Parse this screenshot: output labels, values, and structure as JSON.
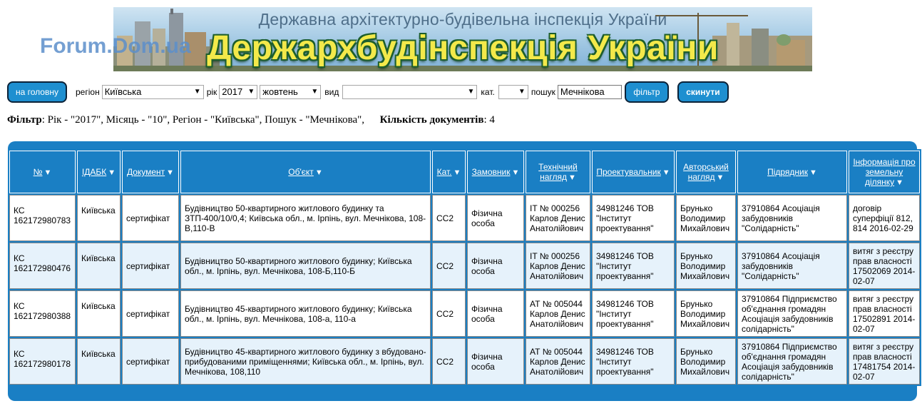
{
  "banner": {
    "subtitle": "Державна архітектурно-будівельна інспекція України",
    "title": "Держархбудінспекція України"
  },
  "watermark": "Forum.Dom.ua",
  "toolbar": {
    "home_label": "на головну",
    "region_label": "регіон",
    "region_value": "Київська",
    "year_label": "рік",
    "year_value": "2017",
    "month_value": "жовтень",
    "type_label": "вид",
    "type_value": "",
    "cat_label": "кат.",
    "cat_value": "",
    "search_label": "пошук",
    "search_value": "Мечнікова",
    "filter_label": "фільтр",
    "reset_label": "скинути"
  },
  "filter_summary": {
    "filter_key": "Фільтр",
    "filter_text": ": Рік - \"2017\", Місяць - \"10\", Регіон - \"Київська\", Пошук - \"Мечнікова\",",
    "count_key": "Кількість документів",
    "count_text": ": 4"
  },
  "table": {
    "headers": [
      "№",
      "ІДАБК",
      "Документ",
      "Об'єкт",
      "Кат.",
      "Замовник",
      "Технічний нагляд",
      "Проектувальник",
      "Авторський нагляд",
      "Підрядник",
      "Інформація про земельну ділянку"
    ],
    "rows": [
      {
        "num": "КС 162172980783",
        "idabk": "Київська",
        "doc": "сертифікат",
        "object": "Будівництво 50-квартирного житлового будинку та ЗТП-400/10/0,4; Київська обл., м. Ірпінь, вул. Мечнікова, 108-В,110-В",
        "cat": "СС2",
        "customer": "Фізична особа",
        "tech": "IT № 000256 Карлов Денис Анатолійович",
        "designer": "34981246 ТОВ \"Інститут проектування\"",
        "author": "Брунько Володимир Михайлович",
        "contractor": "37910864 Асоціація забудовників \"Солідарність\"",
        "land": "договір суперфіції 812, 814 2016-02-29"
      },
      {
        "num": "КС 162172980476",
        "idabk": "Київська",
        "doc": "сертифікат",
        "object": "Будівництво 50-квартирного житлового будинку; Київська обл., м. Ірпінь, вул. Мечнікова, 108-Б,110-Б",
        "cat": "СС2",
        "customer": "Фізична особа",
        "tech": "IT № 000256 Карлов Денис Анатолійович",
        "designer": "34981246 ТОВ \"Інститут проектування\"",
        "author": "Брунько Володимир Михайлович",
        "contractor": "37910864 Асоціація забудовників \"Солідарність\"",
        "land": "витяг з реєстру прав власності 17502069 2014-02-07"
      },
      {
        "num": "КС 162172980388",
        "idabk": "Київська",
        "doc": "сертифікат",
        "object": "Будівництво 45-квартирного житлового будинку; Київська обл., м. Ірпінь, вул. Мечнікова, 108-а, 110-а",
        "cat": "СС2",
        "customer": "Фізична особа",
        "tech": "АТ № 005044 Карлов Денис Анатолійович",
        "designer": "34981246 ТОВ \"Інститут проектування\"",
        "author": "Брунько Володимир Михайлович",
        "contractor": "37910864 Підприємство об'єднання громадян Асоціація забудовників солідарність\"",
        "land": "витяг з реєстру прав власності 17502891 2014-02-07"
      },
      {
        "num": "КС 162172980178",
        "idabk": "Київська",
        "doc": "сертифікат",
        "object": "Будівництво 45-квартирного житлового будинку з вбудовано-прибудованими приміщеннями; Київська обл., м. Ірпінь, вул. Мечнікова, 108,110",
        "cat": "СС2",
        "customer": "Фізична особа",
        "tech": "АТ № 005044 Карлов Денис Анатолійович",
        "designer": "34981246 ТОВ \"Інститут проектування\"",
        "author": "Брунько Володимир Михайлович",
        "contractor": "37910864 Підприємство об'єднання громадян Асоціація забудовників солідарність\"",
        "land": "витяг з реєстру прав власності 17481754 2014-02-07"
      }
    ]
  },
  "colors": {
    "accent": "#1a7fc4",
    "button": "#1e8fd0",
    "row_alt": "#e6f2fb"
  }
}
